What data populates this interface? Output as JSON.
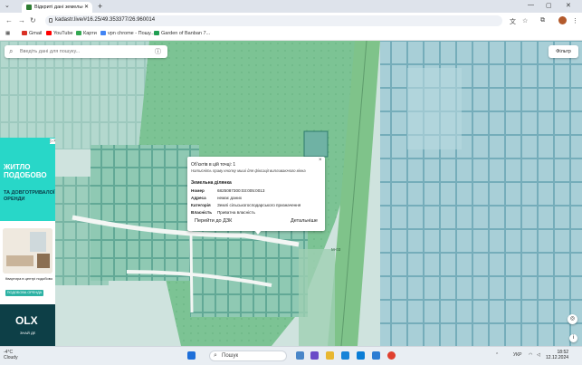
{
  "browser": {
    "tab_title": "Відкриті дані земельного када",
    "new_tab": "+",
    "url": "kadastr.live/#16.25/49.353377/26.960014",
    "bookmarks": [
      {
        "label": "Gmail",
        "color": "#d93025"
      },
      {
        "label": "YouTube",
        "color": "#ff0000"
      },
      {
        "label": "Карти",
        "color": "#34a853"
      },
      {
        "label": "vpn chrome - Пошу...",
        "color": "#4285f4"
      },
      {
        "label": "Garden of Banban 7...",
        "color": "#1f9e52"
      }
    ]
  },
  "search": {
    "placeholder": "Введіть дані для пошуку..."
  },
  "filter_label": "Фільтр",
  "ad": {
    "headline": "ЖИТЛО ПОДОБОВО",
    "subtitle": "ТА ДОВГОТРИВАЛОЇ ОРЕНДИ",
    "caption": "Квартира в центрі подобово",
    "cta": "ПОДОБОВА ОРЕНДА",
    "brand": "OLX",
    "brand_sub": "ЗНАЙ ДЕ"
  },
  "map": {
    "road_label": "M-03"
  },
  "popup": {
    "count": "Об'єктів в цій точці: 1",
    "hint": "Натисніть праву кнопку миші для фіксації випливаючого вікна",
    "section": "Земельна ділянка",
    "fields": [
      {
        "label": "Номер",
        "value": "6825087300:03:005:0013"
      },
      {
        "label": "Адреса",
        "value": "немає даних"
      },
      {
        "label": "Категорія",
        "value": "Землі сільськогосподарського призначення"
      },
      {
        "label": "Власність",
        "value": "Приватна власність"
      }
    ],
    "action_dzk": "Перейти до ДЗК",
    "action_details": "Детальніше"
  },
  "taskbar": {
    "weather_temp": "-4°C",
    "weather_desc": "Cloudy",
    "search_placeholder": "Пошук",
    "lang": "УКР",
    "time": "18:52",
    "date": "12.12.2024"
  }
}
